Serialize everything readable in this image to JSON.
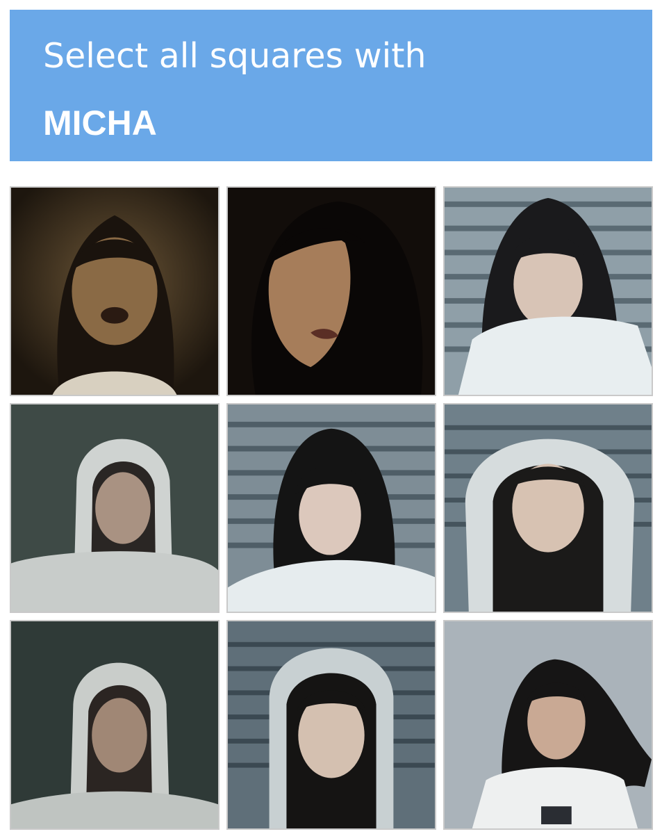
{
  "header": {
    "instruction": "Select all squares with",
    "target": "MICHA",
    "color": "#6aa8e8"
  },
  "tiles": [
    {
      "row": 1,
      "col": 1,
      "photo": "woman-long-hair-dark-warm-light",
      "bg": "#2a2116"
    },
    {
      "row": 1,
      "col": 2,
      "photo": "woman-face-shadowed-dark",
      "bg": "#140f0c"
    },
    {
      "row": 1,
      "col": 3,
      "photo": "woman-white-sleeve-striped-wall",
      "bg": "#8a9aa3"
    },
    {
      "row": 2,
      "col": 1,
      "photo": "woman-white-hood-blurry",
      "bg": "#3d4844"
    },
    {
      "row": 2,
      "col": 2,
      "photo": "woman-arms-folded-striped-wall",
      "bg": "#7d8c95"
    },
    {
      "row": 2,
      "col": 3,
      "photo": "woman-white-hood-striped-wall",
      "bg": "#6e7f89"
    },
    {
      "row": 3,
      "col": 1,
      "photo": "woman-white-hood-dark-blurry",
      "bg": "#2f3a37"
    },
    {
      "row": 3,
      "col": 2,
      "photo": "woman-white-hood-front-striped-wall",
      "bg": "#5f6f79"
    },
    {
      "row": 3,
      "col": 3,
      "photo": "woman-white-shirt-badge-sky",
      "bg": "#aab3ba"
    }
  ]
}
